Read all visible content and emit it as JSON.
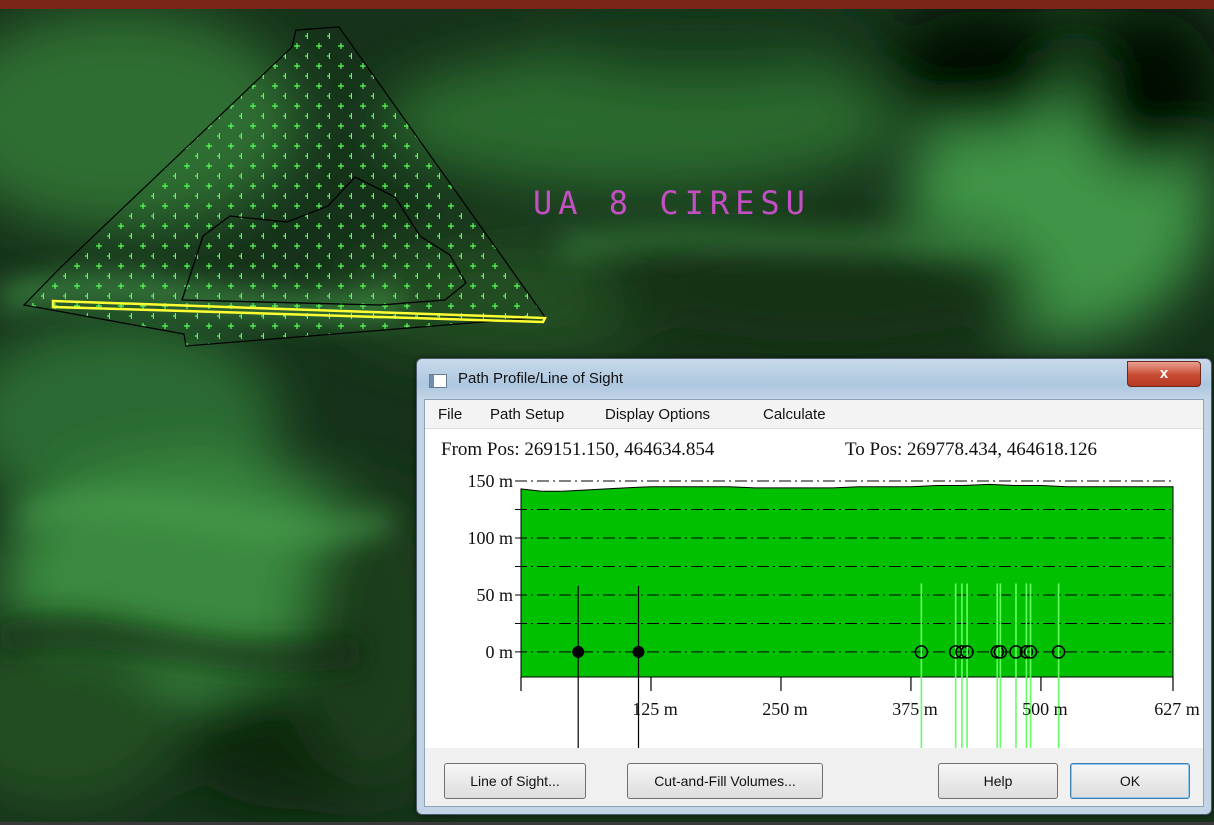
{
  "map": {
    "label": "UA 8 CIRESU",
    "label_color": "#c44fc4",
    "terrain_color": "#2f7a2f",
    "highlight_color": "#ffff33"
  },
  "dialog": {
    "title": "Path Profile/Line of Sight",
    "close_symbol": "x",
    "menu": [
      "File",
      "Path Setup",
      "Display Options",
      "Calculate"
    ],
    "from_pos": "From Pos: 269151.150, 464634.854",
    "to_pos": "To Pos: 269778.434, 464618.126",
    "buttons": {
      "line_of_sight": "Line of Sight...",
      "cut_and_fill": "Cut-and-Fill Volumes...",
      "help": "Help",
      "ok": "OK"
    }
  },
  "chart_data": {
    "type": "area",
    "title": "",
    "xlabel": "",
    "ylabel": "",
    "x_ticks": [
      {
        "value": 125,
        "label": "125 m"
      },
      {
        "value": 250,
        "label": "250 m"
      },
      {
        "value": 375,
        "label": "375 m"
      },
      {
        "value": 500,
        "label": "500 m"
      },
      {
        "value": 627,
        "label": "627 m"
      }
    ],
    "y_ticks": [
      {
        "value": 0,
        "label": "0 m"
      },
      {
        "value": 50,
        "label": "50 m"
      },
      {
        "value": 100,
        "label": "100 m"
      },
      {
        "value": 150,
        "label": "150 m"
      }
    ],
    "xlim": [
      0,
      627
    ],
    "ylim": [
      -22,
      150
    ],
    "profile": {
      "x": [
        0,
        20,
        40,
        60,
        80,
        100,
        125,
        150,
        175,
        200,
        225,
        250,
        275,
        300,
        325,
        350,
        375,
        400,
        425,
        450,
        475,
        500,
        525,
        550,
        575,
        600,
        627
      ],
      "y": [
        143,
        141,
        141,
        142,
        143,
        144,
        145,
        145,
        145,
        145,
        144,
        144,
        144,
        144,
        145,
        145,
        145,
        146,
        146,
        147,
        146,
        146,
        145,
        145,
        145,
        145,
        145
      ],
      "fill_color": "#00c000"
    },
    "markers_filled": [
      {
        "x": 55,
        "y": 0
      },
      {
        "x": 113,
        "y": 0
      }
    ],
    "markers_open": [
      {
        "x": 385,
        "y": 0
      },
      {
        "x": 418,
        "y": 0
      },
      {
        "x": 424,
        "y": 0
      },
      {
        "x": 429,
        "y": 0
      },
      {
        "x": 458,
        "y": 0
      },
      {
        "x": 461,
        "y": 0
      },
      {
        "x": 476,
        "y": 0
      },
      {
        "x": 486,
        "y": 0
      },
      {
        "x": 490,
        "y": 0
      },
      {
        "x": 517,
        "y": 0
      }
    ],
    "grid_style": "dash-dot",
    "marker_color_open": "#66ff66",
    "marker_color_filled": "#000000"
  }
}
